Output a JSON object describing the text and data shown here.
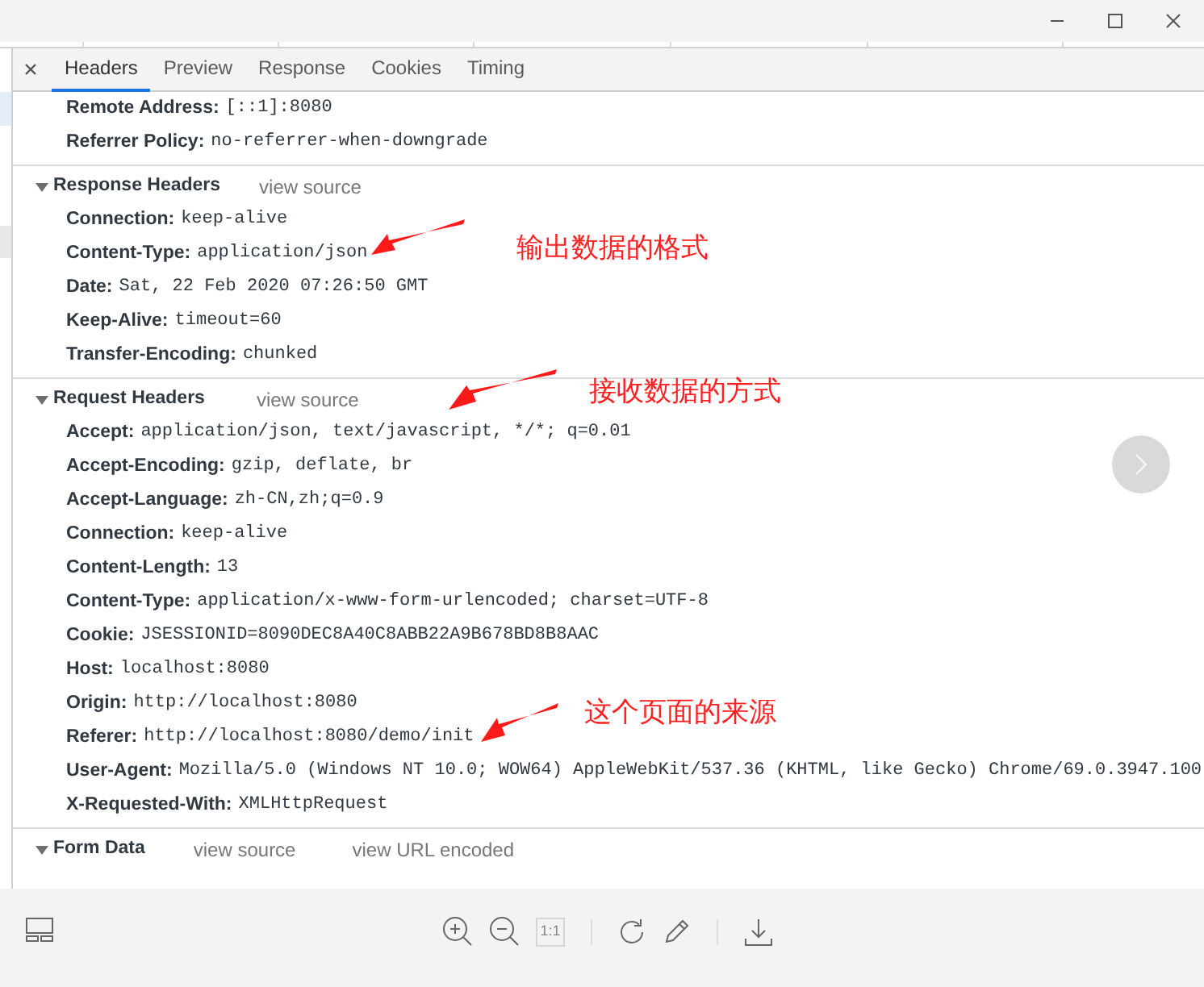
{
  "tabs": [
    {
      "label": "Headers",
      "selected": true
    },
    {
      "label": "Preview",
      "selected": false
    },
    {
      "label": "Response",
      "selected": false
    },
    {
      "label": "Cookies",
      "selected": false
    },
    {
      "label": "Timing",
      "selected": false
    }
  ],
  "general_rows": [
    {
      "name": "Remote Address:",
      "value": "[::1]:8080"
    },
    {
      "name": "Referrer Policy:",
      "value": "no-referrer-when-downgrade"
    }
  ],
  "sections": [
    {
      "title": "Response Headers",
      "expanded": true,
      "links": [
        "view source"
      ],
      "rows": [
        {
          "name": "Connection:",
          "value": "keep-alive"
        },
        {
          "name": "Content-Type:",
          "value": "application/json"
        },
        {
          "name": "Date:",
          "value": "Sat, 22 Feb 2020 07:26:50 GMT"
        },
        {
          "name": "Keep-Alive:",
          "value": "timeout=60"
        },
        {
          "name": "Transfer-Encoding:",
          "value": "chunked"
        }
      ]
    },
    {
      "title": "Request Headers",
      "expanded": true,
      "links": [
        "view source"
      ],
      "rows": [
        {
          "name": "Accept:",
          "value": "application/json, text/javascript, */*; q=0.01"
        },
        {
          "name": "Accept-Encoding:",
          "value": "gzip, deflate, br"
        },
        {
          "name": "Accept-Language:",
          "value": "zh-CN,zh;q=0.9"
        },
        {
          "name": "Connection:",
          "value": "keep-alive"
        },
        {
          "name": "Content-Length:",
          "value": "13"
        },
        {
          "name": "Content-Type:",
          "value": "application/x-www-form-urlencoded; charset=UTF-8"
        },
        {
          "name": "Cookie:",
          "value": "JSESSIONID=8090DEC8A40C8ABB22A9B678BD8B8AAC"
        },
        {
          "name": "Host:",
          "value": "localhost:8080"
        },
        {
          "name": "Origin:",
          "value": "http://localhost:8080"
        },
        {
          "name": "Referer:",
          "value": "http://localhost:8080/demo/init"
        },
        {
          "name": "User-Agent:",
          "value": "Mozilla/5.0 (Windows NT 10.0; WOW64) AppleWebKit/537.36 (KHTML, like Gecko) Chrome/69.0.3947.100"
        },
        {
          "name": "X-Requested-With:",
          "value": "XMLHttpRequest"
        }
      ]
    },
    {
      "title": "Form Data",
      "expanded": true,
      "links": [
        "view source",
        "view URL encoded"
      ]
    }
  ],
  "annotations": [
    {
      "text": "输出数据的格式"
    },
    {
      "text": "接收数据的方式"
    },
    {
      "text": "这个页面的来源"
    }
  ],
  "toolbar": {
    "actual_size_label": "1:1"
  }
}
